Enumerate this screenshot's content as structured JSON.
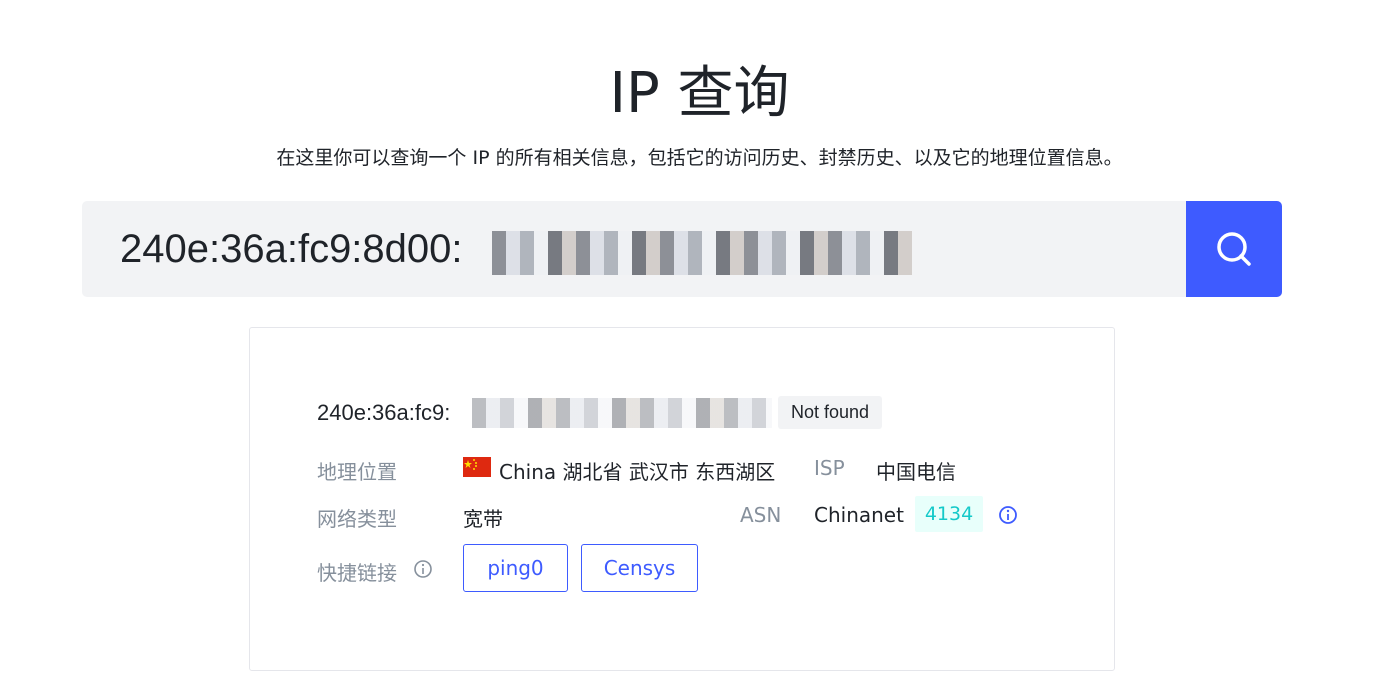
{
  "header": {
    "title": "IP 查询",
    "subtitle": "在这里你可以查询一个 IP 的所有相关信息，包括它的访问历史、封禁历史、以及它的地理位置信息。"
  },
  "search": {
    "value": "240e:36a:fc9:8d00:",
    "button_icon": "search-icon",
    "accent": "#3e5bff"
  },
  "result": {
    "ip": "240e:36a:fc9:",
    "status": "Not found",
    "fields": {
      "location_label": "地理位置",
      "location_flag": "china-flag-icon",
      "location_value": "China 湖北省 武汉市 东西湖区",
      "isp_label": "ISP",
      "isp_value": "中国电信",
      "network_label": "网络类型",
      "network_value": "宽带",
      "asn_label": "ASN",
      "asn_name": "Chinanet",
      "asn_number": "4134",
      "links_label": "快捷链接"
    },
    "links": [
      {
        "label": "ping0"
      },
      {
        "label": "Censys"
      }
    ]
  }
}
